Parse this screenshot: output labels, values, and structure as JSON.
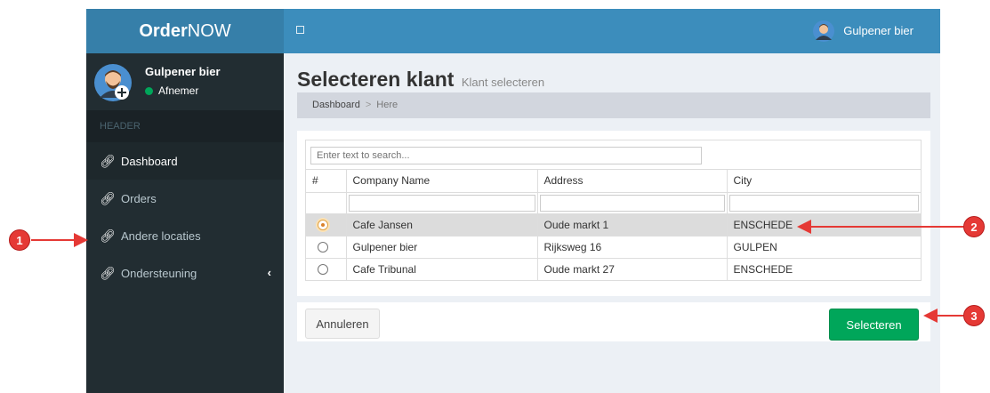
{
  "app": {
    "logo_bold": "Order",
    "logo_rest": "NOW"
  },
  "user": {
    "name": "Gulpener bier",
    "status": "Afnemer"
  },
  "sidebar": {
    "header": "HEADER",
    "items": [
      {
        "label": "Dashboard",
        "icon": "link-icon"
      },
      {
        "label": "Orders",
        "icon": "link-icon"
      },
      {
        "label": "Andere locaties",
        "icon": "link-icon"
      },
      {
        "label": "Ondersteuning",
        "icon": "link-icon"
      }
    ]
  },
  "topbar": {
    "user_name": "Gulpener bier"
  },
  "page": {
    "title": "Selecteren klant",
    "subtitle": "Klant selecteren"
  },
  "breadcrumb": {
    "root": "Dashboard",
    "separator": ">",
    "current": "Here"
  },
  "grid": {
    "search_placeholder": "Enter text to search...",
    "columns": [
      "#",
      "Company Name",
      "Address",
      "City"
    ],
    "rows": [
      {
        "company": "Cafe Jansen",
        "address": "Oude markt 1",
        "city": "ENSCHEDE",
        "selected": true
      },
      {
        "company": "Gulpener bier",
        "address": "Rijksweg 16",
        "city": "GULPEN",
        "selected": false
      },
      {
        "company": "Cafe Tribunal",
        "address": "Oude markt 27",
        "city": "ENSCHEDE",
        "selected": false
      }
    ]
  },
  "buttons": {
    "cancel": "Annuleren",
    "select": "Selecteren"
  },
  "annotations": [
    "1",
    "2",
    "3"
  ],
  "colors": {
    "logo_bar": "#367fa9",
    "topbar": "#3c8dbc",
    "sidebar": "#222d32",
    "success": "#00a65a",
    "annotation": "#e53935"
  }
}
